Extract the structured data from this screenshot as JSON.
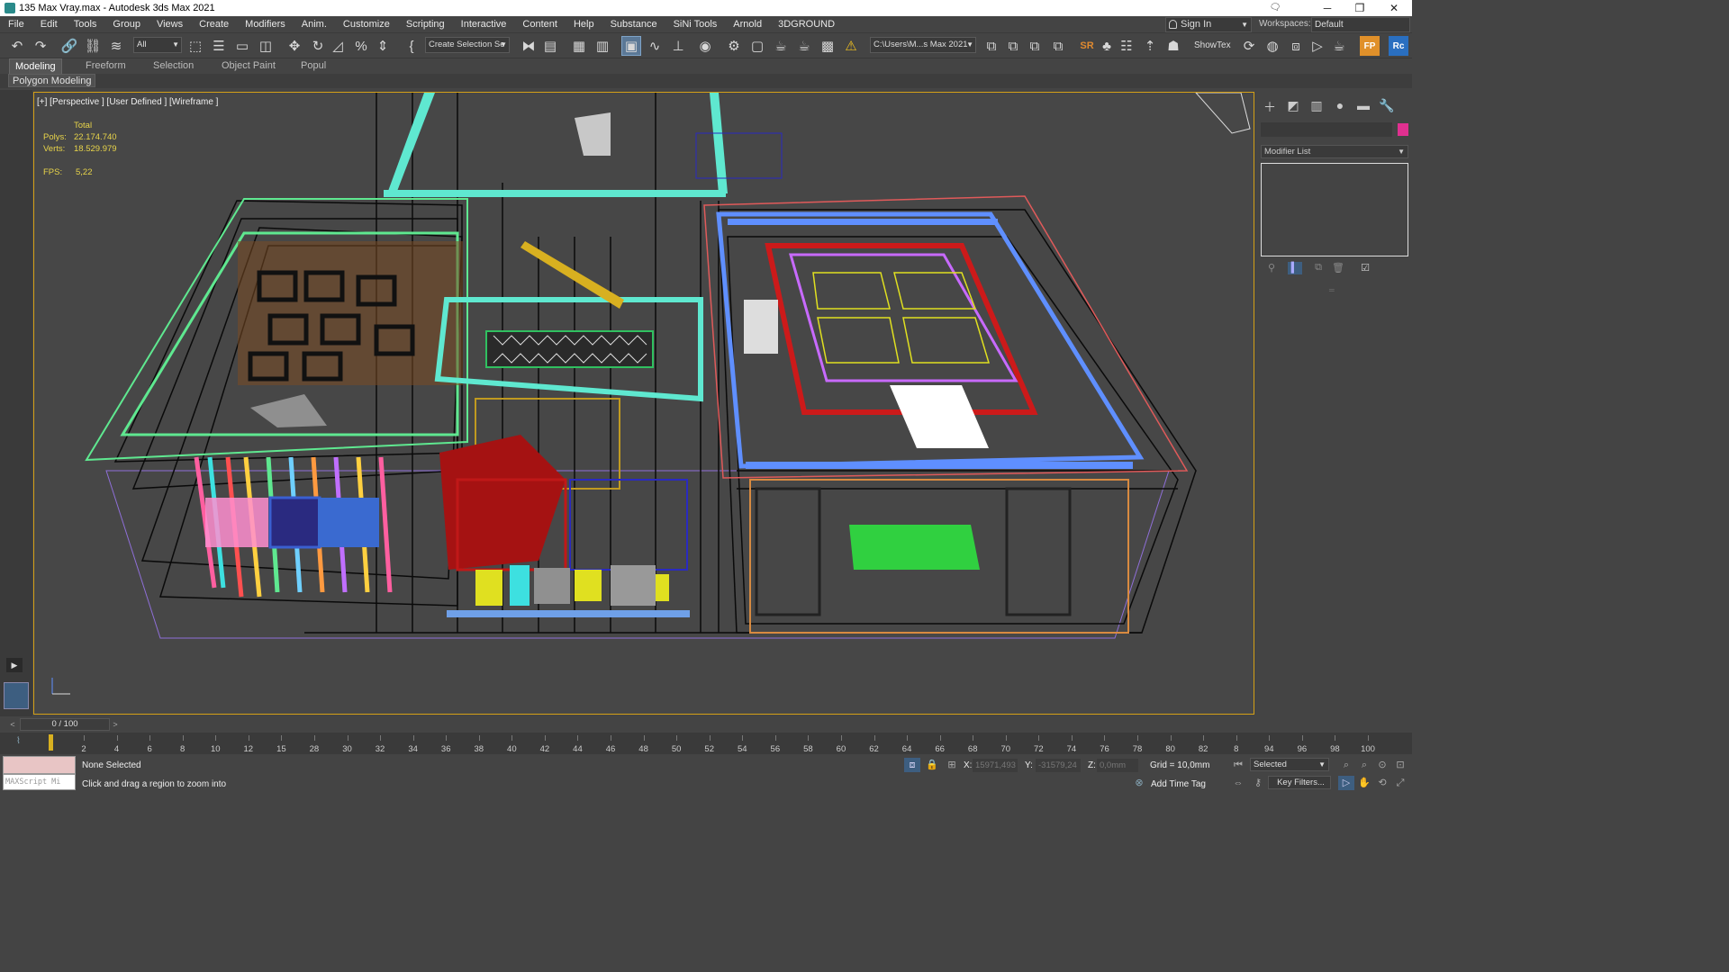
{
  "window": {
    "title": "135 Max Vray.max - Autodesk 3ds Max 2021",
    "controls": {
      "minimize": "─",
      "maximize": "❐",
      "close": "✕"
    }
  },
  "menu": [
    "File",
    "Edit",
    "Tools",
    "Group",
    "Views",
    "Create",
    "Modifiers",
    "Anim.",
    "Customize",
    "Scripting",
    "Interactive",
    "Content",
    "Help",
    "Substance",
    "SiNi Tools",
    "Arnold",
    "3DGROUND"
  ],
  "account": {
    "sign_in": "Sign In",
    "workspaces_label": "Workspaces:",
    "workspace": "Default"
  },
  "toolbar": {
    "filter": "All",
    "selection_set": "Create Selection Se",
    "project_path": "C:\\Users\\M...s Max 2021",
    "showtex": "ShowTex",
    "sr_label": "SR",
    "fp_label": "FP",
    "rc_label": "Rc"
  },
  "ribbon": {
    "tabs": [
      "Modeling",
      "Freeform",
      "Selection",
      "Object Paint",
      "Popul"
    ],
    "active": "Modeling",
    "panel_label": "Polygon Modeling"
  },
  "viewport": {
    "label": "[+] [Perspective ] [User Defined ] [Wireframe ]",
    "stats": {
      "header": "Total",
      "polys_label": "Polys:",
      "polys": "22.174.740",
      "verts_label": "Verts:",
      "verts": "18.529.979",
      "fps_label": "FPS:",
      "fps": "5,22"
    }
  },
  "command_panel": {
    "modifier_list": "Modifier List",
    "object_color": "#e03090"
  },
  "timeline": {
    "frame_display": "0 / 100",
    "ticks": [
      "2",
      "4",
      "6",
      "8",
      "10",
      "12",
      "15",
      "28",
      "30",
      "32",
      "34",
      "36",
      "38",
      "40",
      "42",
      "44",
      "46",
      "48",
      "50",
      "52",
      "54",
      "56",
      "58",
      "60",
      "62",
      "64",
      "66",
      "68",
      "70",
      "72",
      "74",
      "76",
      "78",
      "80",
      "82",
      "8",
      "94",
      "96",
      "98",
      "100"
    ]
  },
  "status": {
    "selection": "None Selected",
    "prompt": "Click and drag a region to zoom into",
    "maxscript": "MAXScript Mi",
    "x_label": "X:",
    "x_value": "15971,493",
    "y_label": "Y:",
    "y_value": "-31579,24",
    "z_label": "Z:",
    "z_value": "0,0mm",
    "grid": "Grid = 10,0mm",
    "add_time_tag": "Add Time Tag",
    "key_mode": "Selected",
    "key_filters": "Key Filters..."
  }
}
